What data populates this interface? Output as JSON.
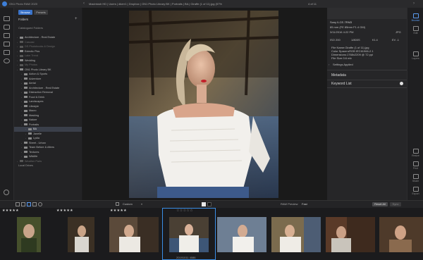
{
  "titlebar": {
    "app_title": "ON1 Photo RAW 2020",
    "back_glyph": "‹",
    "forward_glyph": "›",
    "path": "Macintosh HD | Users | dkerr1 | Dropbox | ON1 Photo Library BK | Portraits | BA | Giraffe (1 of 11).jpg (57%",
    "image_count": "4 of 11"
  },
  "sidebar": {
    "tabs": [
      {
        "label": "Browse"
      },
      {
        "label": "Presets"
      }
    ],
    "folders_title": "Folders",
    "catalog_label": "Catalogued Folders",
    "items": [
      {
        "label": "Architecture - Real Estate",
        "level": 1,
        "dim": false
      },
      {
        "label": "Cascasi",
        "level": 1,
        "dim": true
      },
      {
        "label": "DS Photobooks & Design",
        "level": 1,
        "dim": true
      },
      {
        "label": "Eclectic Pics",
        "level": 1,
        "dim": false
      },
      {
        "label": "Lake Trend",
        "level": 1,
        "dim": true
      },
      {
        "label": "Wedding",
        "level": 1,
        "dim": false
      },
      {
        "label": "My Photos",
        "level": 1,
        "dim": true
      },
      {
        "label": "ON1 Photo Library BK",
        "level": 1,
        "dim": false
      },
      {
        "label": "Action & Sports",
        "level": 2,
        "dim": false
      },
      {
        "label": "Adventure",
        "level": 2,
        "dim": false
      },
      {
        "label": "Aerial",
        "level": 2,
        "dim": false
      },
      {
        "label": "Architecture - Real Estate",
        "level": 2,
        "dim": false
      },
      {
        "label": "Distraction Removal",
        "level": 2,
        "dim": false
      },
      {
        "label": "Food & Drink",
        "level": 2,
        "dim": false
      },
      {
        "label": "Landscapes",
        "level": 2,
        "dim": false
      },
      {
        "label": "Lifestyle",
        "level": 2,
        "dim": false
      },
      {
        "label": "Macro",
        "level": 2,
        "dim": false
      },
      {
        "label": "Masking",
        "level": 2,
        "dim": false
      },
      {
        "label": "Nature",
        "level": 2,
        "dim": false
      },
      {
        "label": "Portraits",
        "level": 2,
        "dim": false
      },
      {
        "label": "BA",
        "level": 3,
        "dim": false,
        "selected": true
      },
      {
        "label": "Janelle",
        "level": 3,
        "dim": false
      },
      {
        "label": "Lydia",
        "level": 3,
        "dim": false
      },
      {
        "label": "Street - Urban",
        "level": 2,
        "dim": false
      },
      {
        "label": "Team Before & Afters",
        "level": 2,
        "dim": false
      },
      {
        "label": "Textures",
        "level": 2,
        "dim": false
      },
      {
        "label": "Wildlife",
        "level": 2,
        "dim": false
      },
      {
        "label": "Weather Parts",
        "level": 1,
        "dim": true
      }
    ],
    "local_drives_label": "Local Drives"
  },
  "inspector": {
    "camera": "Sony ILCE-7RM3",
    "lens": "85 mm (FE 85mm F1.4 GM)",
    "date": "3/11/2016 4:22 PM",
    "format": "JPG",
    "iso": "ISO 200",
    "shutter": "1/800S",
    "aperture": "f/1.4",
    "ev": "EV -1",
    "filename": "File Name:Giraffe (1 of 11).jpg",
    "colorspace": "Color Space:sRGB IEC61966-2.1",
    "dimensions": "Dimensions:1768x2209 @ 72 ppi",
    "filesize": "File Size:3.6 mb",
    "settings_applied": "Settings Applied",
    "metadata_title": "Metadata",
    "keyword_title": "Keyword List"
  },
  "rightrail": [
    {
      "label": "Browse",
      "active": true
    },
    {
      "label": "Edit",
      "active": false
    },
    {
      "label": "Layers",
      "active": false
    },
    {
      "label": "Resize",
      "active": false
    },
    {
      "label": "Print",
      "active": false
    },
    {
      "label": "Share",
      "active": false
    },
    {
      "label": "Export",
      "active": false
    }
  ],
  "bottombar": {
    "sort_value": "Custom",
    "preview_label": "RAW Preview",
    "preview_value": "Fast",
    "reset_all": "Reset All",
    "sync": "Sync"
  },
  "filmstrip": {
    "selected_index": 3,
    "caption": "20191011 4086",
    "stars_visible": [
      {
        "rating": 5
      },
      {
        "rating": 5
      },
      {
        "rating": 5
      },
      {
        "rating": 5
      }
    ],
    "thumbnails": [
      {
        "label": "thumb-1"
      },
      {
        "label": "thumb-2"
      },
      {
        "label": "thumb-3"
      },
      {
        "label": "thumb-4"
      },
      {
        "label": "thumb-5"
      },
      {
        "label": "thumb-6"
      },
      {
        "label": "thumb-7"
      },
      {
        "label": "thumb-8"
      }
    ]
  },
  "colors": {
    "accent": "#3a73c9",
    "background": "#1c1c1e",
    "panel": "#232325"
  }
}
